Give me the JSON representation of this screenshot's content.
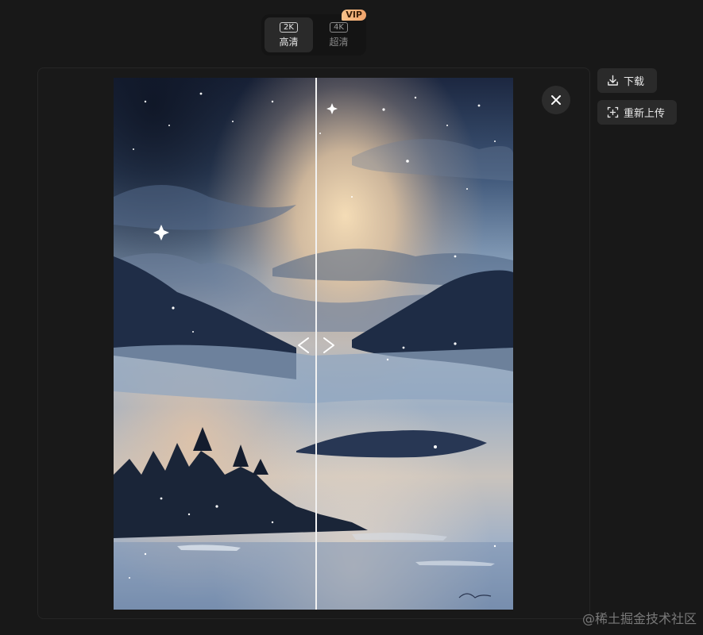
{
  "quality": {
    "options": [
      {
        "resolution": "2K",
        "label": "高清",
        "active": true
      },
      {
        "resolution": "4K",
        "label": "超清",
        "active": false,
        "badge": "VIP"
      }
    ]
  },
  "actions": {
    "download_label": "下载",
    "reupload_label": "重新上传"
  },
  "compare": {
    "left_arrow": "<",
    "right_arrow": ">"
  },
  "watermark": "@稀土掘金技术社区",
  "colors": {
    "background": "#181818",
    "panel": "#191919",
    "button": "#2a2a2a",
    "vip_badge": "#f0a36a"
  }
}
